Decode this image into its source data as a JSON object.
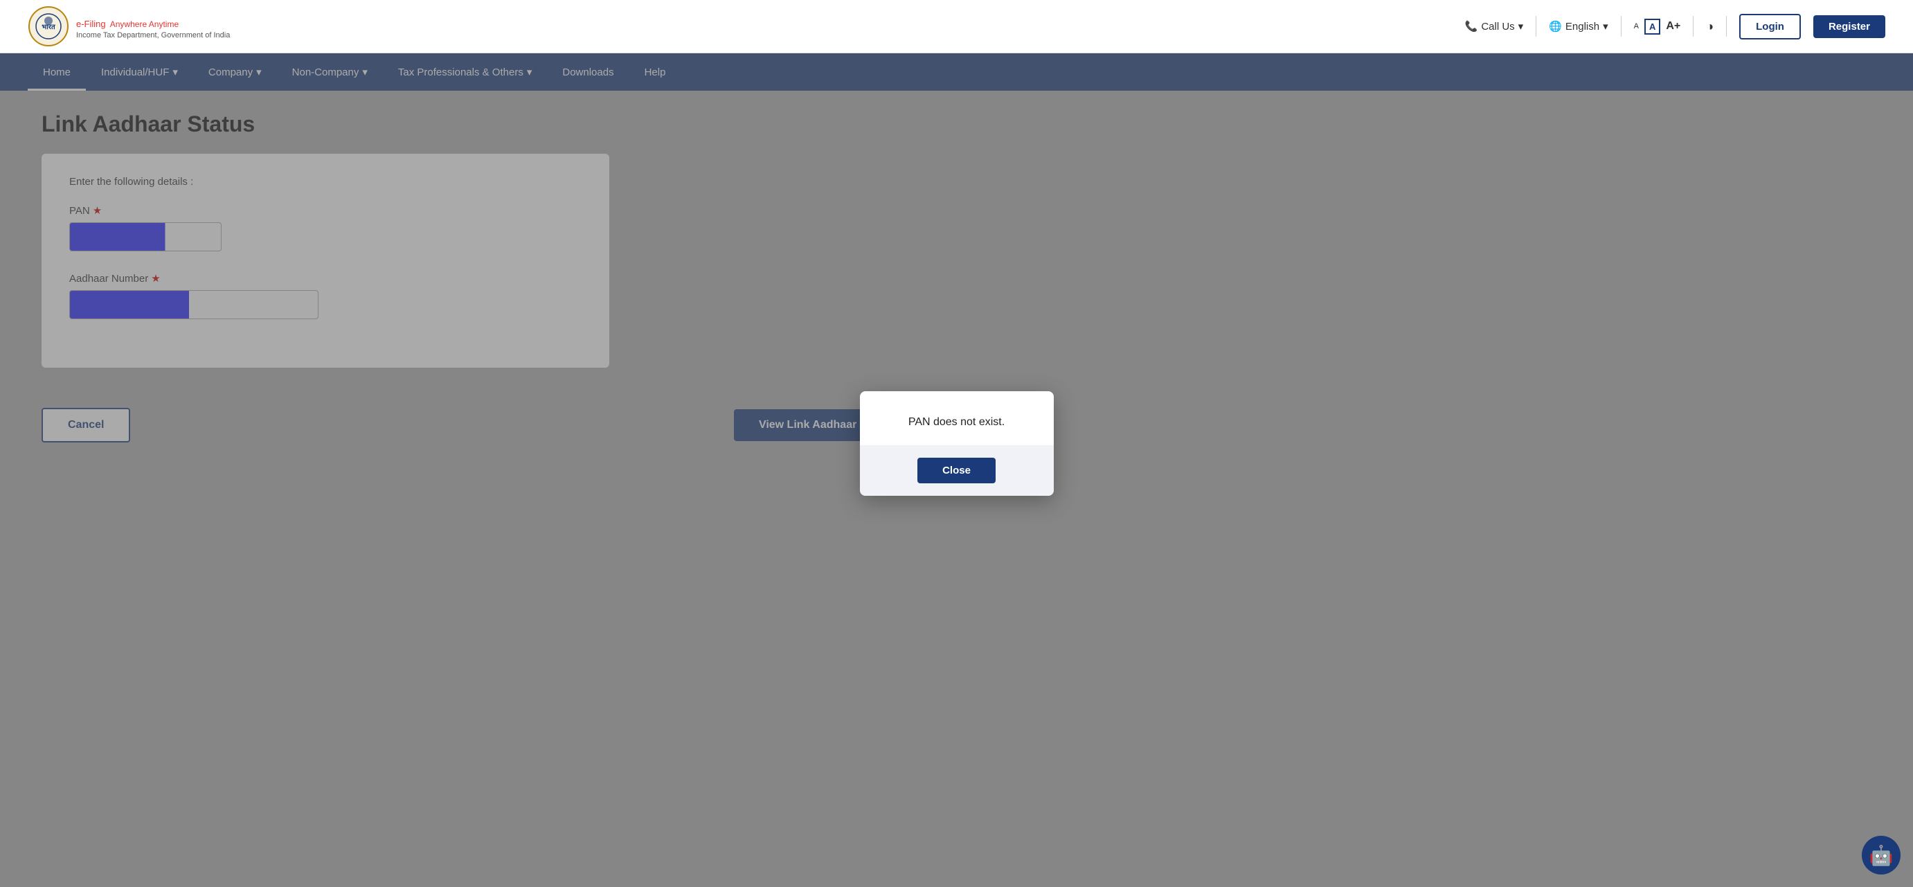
{
  "header": {
    "logo_alt": "Income Tax Department Logo",
    "efiling_label": "e-Filing",
    "efiling_tagline": "Anywhere Anytime",
    "dept_label": "Income Tax Department, Government of India",
    "call_us": "Call Us",
    "language": "English",
    "font_small": "A",
    "font_medium": "A",
    "font_large": "A+",
    "contrast_icon": "◑",
    "login_label": "Login",
    "register_label": "Register"
  },
  "nav": {
    "items": [
      {
        "id": "home",
        "label": "Home",
        "active": true,
        "has_dropdown": false
      },
      {
        "id": "individual-huf",
        "label": "Individual/HUF",
        "active": false,
        "has_dropdown": true
      },
      {
        "id": "company",
        "label": "Company",
        "active": false,
        "has_dropdown": true
      },
      {
        "id": "non-company",
        "label": "Non-Company",
        "active": false,
        "has_dropdown": true
      },
      {
        "id": "tax-professionals",
        "label": "Tax Professionals & Others",
        "active": false,
        "has_dropdown": true
      },
      {
        "id": "downloads",
        "label": "Downloads",
        "active": false,
        "has_dropdown": false
      },
      {
        "id": "help",
        "label": "Help",
        "active": false,
        "has_dropdown": false
      }
    ]
  },
  "page": {
    "title": "Link Aadhaar Status",
    "form_desc": "Enter the following details :",
    "pan_label": "PAN",
    "pan_required": true,
    "aadhaar_label": "Aadhaar Number",
    "aadhaar_required": true,
    "cancel_label": "Cancel",
    "view_status_label": "View Link Aadhaar Status",
    "view_status_arrow": "›"
  },
  "modal": {
    "message": "PAN does not exist.",
    "close_label": "Close"
  },
  "footer_bot_icon": "🤖"
}
